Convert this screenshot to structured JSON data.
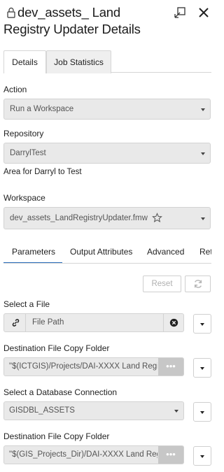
{
  "header": {
    "title_line1": "dev_assets_ Land",
    "title_line2": "Registry Updater Details",
    "lock_icon": "lock-icon",
    "popout_icon": "popout-icon",
    "close_icon": "close-icon"
  },
  "top_tabs": [
    {
      "label": "Details",
      "active": true
    },
    {
      "label": "Job Statistics",
      "active": false
    }
  ],
  "action": {
    "label": "Action",
    "value": "Run a Workspace"
  },
  "repository": {
    "label": "Repository",
    "value": "DarrylTest",
    "description": "Area for Darryl to Test"
  },
  "workspace": {
    "label": "Workspace",
    "value": "dev_assets_LandRegistryUpdater.fmw",
    "star_icon": "star-icon"
  },
  "sub_tabs": [
    {
      "label": "Parameters",
      "active": true
    },
    {
      "label": "Output Attributes",
      "active": false
    },
    {
      "label": "Advanced",
      "active": false
    },
    {
      "label": "Ret",
      "active": false
    }
  ],
  "actions": {
    "reset_label": "Reset",
    "refresh_icon": "refresh-icon"
  },
  "params": {
    "select_file": {
      "label": "Select a File",
      "placeholder": "File Path",
      "link_icon": "link-icon",
      "clear_icon": "clear-icon"
    },
    "dest1": {
      "label": "Destination File Copy Folder",
      "value": "\"$(ICTGIS)/Projects/DAI-XXXX Land Regis",
      "ellipsis": "•••"
    },
    "db": {
      "label": "Select a Database Connection",
      "value": "GISDBL_ASSETS"
    },
    "dest2": {
      "label": "Destination File Copy Folder",
      "value": "\"$(GIS_Projects_Dir)/DAI-XXXX Land Reg",
      "ellipsis": "•••"
    }
  },
  "colors": {
    "accent": "#2a6ebb",
    "field_bg": "#e9e9e9"
  }
}
